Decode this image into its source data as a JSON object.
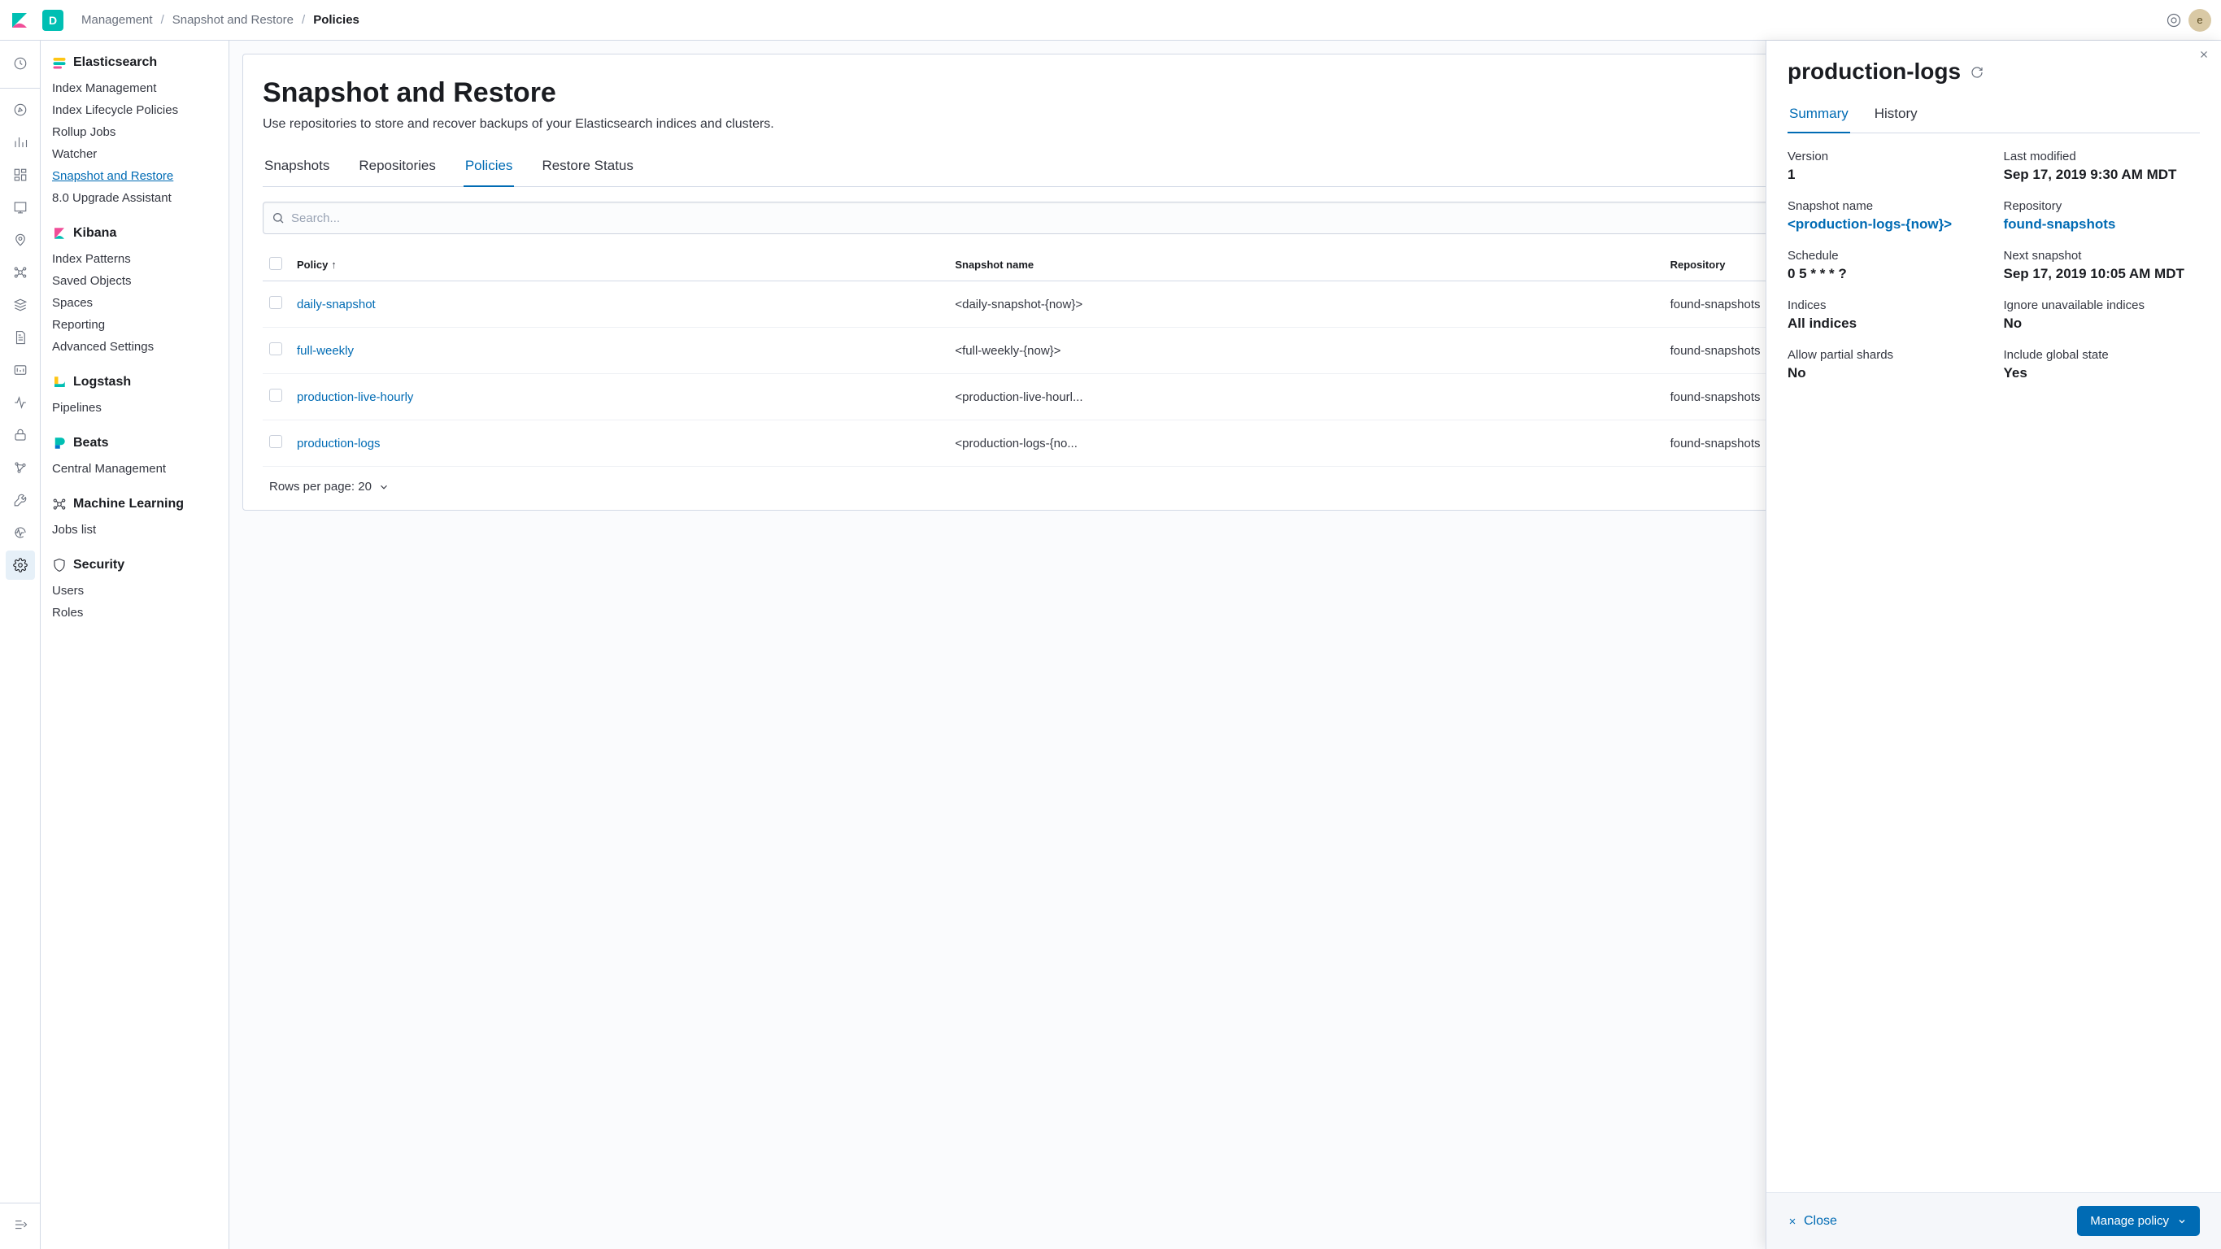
{
  "header": {
    "space_initial": "D",
    "breadcrumbs": [
      "Management",
      "Snapshot and Restore",
      "Policies"
    ],
    "user_initial": "e"
  },
  "sidebar": {
    "sections": [
      {
        "title": "Elasticsearch",
        "items": [
          "Index Management",
          "Index Lifecycle Policies",
          "Rollup Jobs",
          "Watcher",
          "Snapshot and Restore",
          "8.0 Upgrade Assistant"
        ],
        "active_index": 4
      },
      {
        "title": "Kibana",
        "items": [
          "Index Patterns",
          "Saved Objects",
          "Spaces",
          "Reporting",
          "Advanced Settings"
        ],
        "active_index": -1
      },
      {
        "title": "Logstash",
        "items": [
          "Pipelines"
        ],
        "active_index": -1
      },
      {
        "title": "Beats",
        "items": [
          "Central Management"
        ],
        "active_index": -1
      },
      {
        "title": "Machine Learning",
        "items": [
          "Jobs list"
        ],
        "active_index": -1
      },
      {
        "title": "Security",
        "items": [
          "Users",
          "Roles"
        ],
        "active_index": -1
      }
    ]
  },
  "page": {
    "title": "Snapshot and Restore",
    "subtitle": "Use repositories to store and recover backups of your Elasticsearch indices and clusters.",
    "tabs": [
      "Snapshots",
      "Repositories",
      "Policies",
      "Restore Status"
    ],
    "active_tab": 2,
    "search_placeholder": "Search...",
    "columns": [
      "Policy",
      "Snapshot name",
      "Repository"
    ],
    "rows": [
      {
        "policy": "daily-snapshot",
        "snapshot": "<daily-snapshot-{now}>",
        "repo": "found-snapshots"
      },
      {
        "policy": "full-weekly",
        "snapshot": "<full-weekly-{now}>",
        "repo": "found-snapshots"
      },
      {
        "policy": "production-live-hourly",
        "snapshot": "<production-live-hourl...",
        "repo": "found-snapshots"
      },
      {
        "policy": "production-logs",
        "snapshot": "<production-logs-{no...",
        "repo": "found-snapshots"
      }
    ],
    "rows_per_page_label": "Rows per page: 20"
  },
  "flyout": {
    "title": "production-logs",
    "tabs": [
      "Summary",
      "History"
    ],
    "active_tab": 0,
    "details": [
      {
        "label": "Version",
        "value": "1"
      },
      {
        "label": "Last modified",
        "value": "Sep 17, 2019 9:30 AM MDT"
      },
      {
        "label": "Snapshot name",
        "value": "<production-logs-{now}>",
        "link": true
      },
      {
        "label": "Repository",
        "value": "found-snapshots",
        "link": true
      },
      {
        "label": "Schedule",
        "value": "0 5 * * * ?"
      },
      {
        "label": "Next snapshot",
        "value": "Sep 17, 2019 10:05 AM MDT"
      },
      {
        "label": "Indices",
        "value": "All indices"
      },
      {
        "label": "Ignore unavailable indices",
        "value": "No"
      },
      {
        "label": "Allow partial shards",
        "value": "No"
      },
      {
        "label": "Include global state",
        "value": "Yes"
      }
    ],
    "close_label": "Close",
    "manage_label": "Manage policy"
  }
}
